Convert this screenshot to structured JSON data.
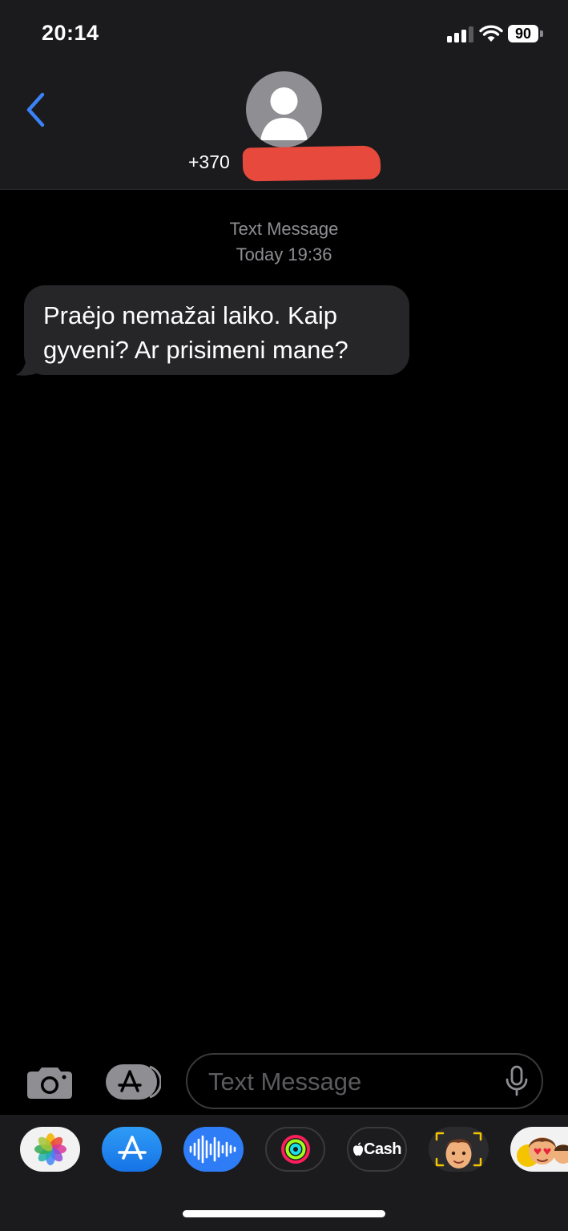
{
  "status_bar": {
    "time": "20:14",
    "battery_percent": "90",
    "signal_bars_filled": 3,
    "signal_bars_total": 4
  },
  "header": {
    "back_icon": "chevron-left-icon",
    "avatar_icon": "person-silhouette-icon",
    "contact_number_prefix": "+370",
    "accent_color": "#3b82f6"
  },
  "conversation": {
    "service_label": "Text Message",
    "timestamp": "Today 19:36",
    "messages": [
      {
        "direction": "incoming",
        "text": "Praėjo nemažai laiko. Kaip gyveni? Ar prisimeni mane?"
      }
    ]
  },
  "composer": {
    "placeholder": "Text Message",
    "camera_icon": "camera-icon",
    "apps_icon": "app-store-icon",
    "mic_icon": "microphone-icon"
  },
  "app_drawer": {
    "apps": [
      {
        "name": "Photos",
        "icon": "photos-icon"
      },
      {
        "name": "App Store",
        "icon": "app-store-icon"
      },
      {
        "name": "Audio Message",
        "icon": "audio-waveform-icon"
      },
      {
        "name": "Fitness",
        "icon": "activity-rings-icon"
      },
      {
        "name": "Apple Cash",
        "icon": "apple-cash-icon",
        "label": "Cash"
      },
      {
        "name": "Memoji",
        "icon": "memoji-icon"
      },
      {
        "name": "Memoji Stickers",
        "icon": "memoji-stickers-icon"
      }
    ]
  }
}
